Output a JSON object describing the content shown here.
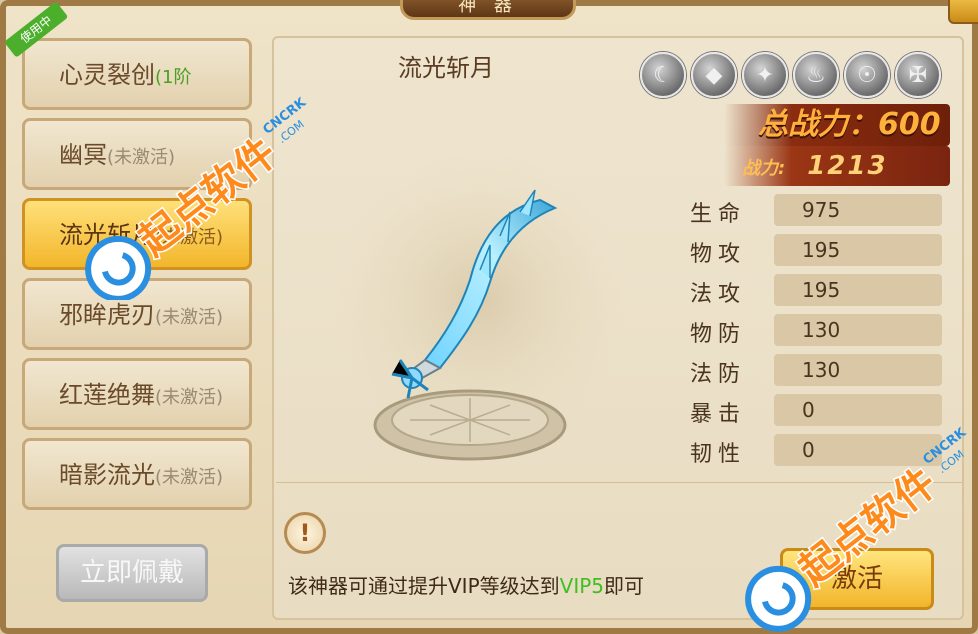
{
  "window": {
    "title": "神 器"
  },
  "artifacts": [
    {
      "name": "心灵裂创",
      "status": "(1阶",
      "badge": "使用中"
    },
    {
      "name": "幽冥",
      "status": "(未激活)"
    },
    {
      "name": "流光斩月",
      "status": "(未激活)"
    },
    {
      "name": "邪眸虎刃",
      "status": "(未激活)"
    },
    {
      "name": "红莲绝舞",
      "status": "(未激活)"
    },
    {
      "name": "暗影流光",
      "status": "(未激活)"
    }
  ],
  "equip_button": "立即佩戴",
  "selected": {
    "name": "流光斩月",
    "total_power_label": "总战力：",
    "total_power_value": "600",
    "power_label": "战力:",
    "power_value": "1213",
    "stats": [
      {
        "label": "生命",
        "value": "975"
      },
      {
        "label": "物攻",
        "value": "195"
      },
      {
        "label": "法攻",
        "value": "195"
      },
      {
        "label": "物防",
        "value": "130"
      },
      {
        "label": "法防",
        "value": "130"
      },
      {
        "label": "暴击",
        "value": "0"
      },
      {
        "label": "韧性",
        "value": "0"
      }
    ]
  },
  "hint": {
    "prefix": "该神器可通过提升VIP等级达到",
    "vip": "VIP5",
    "suffix": "即可"
  },
  "activate_button": "激活",
  "runes": [
    "moon-rune-icon",
    "crystal-rune-icon",
    "dragon-rune-icon",
    "flame-rune-icon",
    "mask-rune-icon",
    "demon-rune-icon"
  ],
  "watermark": {
    "brand": "起点软件",
    "site": "CNCRK",
    "tld": ".COM"
  }
}
